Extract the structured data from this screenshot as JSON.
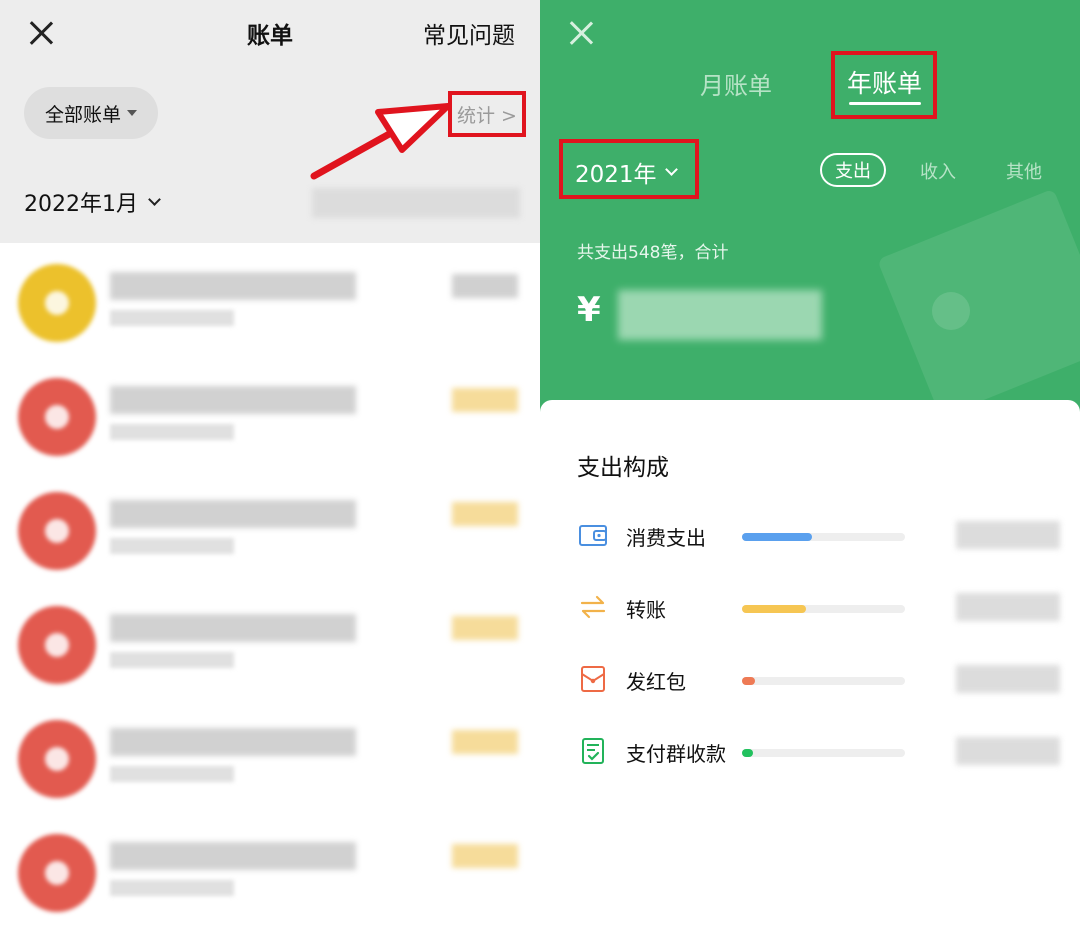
{
  "left": {
    "title": "账单",
    "faq": "常见问题",
    "filter": "全部账单",
    "stats": "统计 >",
    "month": "2022年1月",
    "transactions": [
      {
        "icon": "yellow-merchant-icon",
        "amount_color": "#d0d0d0"
      },
      {
        "icon": "red-envelope-icon",
        "amount_color": "#f6dc9a"
      },
      {
        "icon": "red-envelope-icon",
        "amount_color": "#f6dc9a"
      },
      {
        "icon": "red-envelope-icon",
        "amount_color": "#f6dc9a"
      },
      {
        "icon": "red-envelope-icon",
        "amount_color": "#f6dc9a"
      },
      {
        "icon": "red-envelope-icon",
        "amount_color": "#f6dc9a"
      }
    ]
  },
  "right": {
    "tabs": {
      "month": "月账单",
      "year": "年账单"
    },
    "year": "2021年",
    "types": {
      "out": "支出",
      "in": "收入",
      "other": "其他"
    },
    "summary": "共支出548笔，合计",
    "currency": "¥",
    "breakdown": {
      "title": "支出构成",
      "categories": [
        {
          "label": "消费支出",
          "icon": "wallet-icon",
          "color": "#5aa0ee",
          "share": 0.43
        },
        {
          "label": "转账",
          "icon": "transfer-arrows-icon",
          "color": "#f6c653",
          "share": 0.39
        },
        {
          "label": "发红包",
          "icon": "red-packet-icon",
          "color": "#ee7a55",
          "share": 0.08
        },
        {
          "label": "支付群收款",
          "icon": "group-payment-icon",
          "color": "#22c15e",
          "share": 0.07
        }
      ]
    }
  },
  "colors": {
    "accent_green": "#3eaf6a",
    "highlight_red": "#e0141e"
  }
}
